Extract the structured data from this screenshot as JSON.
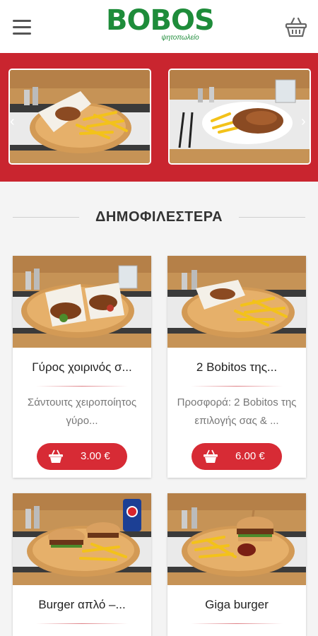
{
  "header": {
    "logo": "BOBOS",
    "logo_sub": "ψητοπωλείο"
  },
  "section": {
    "title": "ΔΗΜΟΦΙΛΕΣΤΕΡΑ"
  },
  "products": [
    {
      "name": "Γύρος χοιρινός σ...",
      "desc": "Σάντουιτς χειροποίητος γύρο...",
      "price": "3.00 €"
    },
    {
      "name": "2 Bobitos της...",
      "desc": "Προσφορά: 2 Bobitos της επιλογής σας & ...",
      "price": "6.00 €"
    },
    {
      "name": "Burger απλό –...",
      "desc": "",
      "price": ""
    },
    {
      "name": "Giga burger",
      "desc": "",
      "price": ""
    }
  ],
  "colors": {
    "brand_green": "#1e8c3a",
    "brand_red": "#c9252f",
    "button_red": "#d72b35"
  }
}
